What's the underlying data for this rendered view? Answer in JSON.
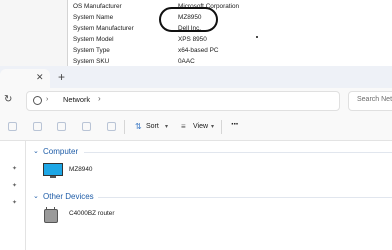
{
  "sysinfo": {
    "rows": [
      {
        "key": "OS Manufacturer",
        "value": "Microsoft Corporation"
      },
      {
        "key": "System Name",
        "value": "MZ8950"
      },
      {
        "key": "System Manufacturer",
        "value": "Dell Inc."
      },
      {
        "key": "System Model",
        "value": "XPS 8950"
      },
      {
        "key": "System Type",
        "value": "x64-based PC"
      },
      {
        "key": "System SKU",
        "value": "0AAC"
      }
    ]
  },
  "explorer": {
    "titlebar": {
      "tab_close": "✕",
      "new_tab": "+"
    },
    "addressbar": {
      "refresh_glyph": "↻",
      "location": "Network",
      "search_placeholder": "Search Net"
    },
    "toolbar": {
      "sort_label": "Sort",
      "view_label": "View",
      "more_label": "···"
    },
    "groups": [
      {
        "label": "Computer",
        "items": [
          {
            "name": "MZ8940",
            "icon": "monitor-icon"
          }
        ]
      },
      {
        "label": "Other Devices",
        "items": [
          {
            "name": "C4000BZ router",
            "icon": "router-icon"
          }
        ]
      }
    ]
  },
  "icons": {
    "accent": "#1f5da8",
    "monitor": "#1ea7e6"
  }
}
